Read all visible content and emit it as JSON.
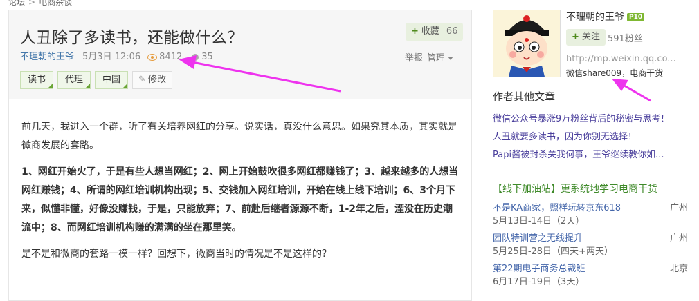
{
  "breadcrumb": {
    "items": [
      "论坛",
      "电商杂谈"
    ]
  },
  "article": {
    "title": "人丑除了多读书，还能做什么？",
    "favorite": {
      "label": "收藏",
      "count": "66"
    },
    "meta": {
      "author": "不理朝的王爷",
      "date": "5月3日 12:06",
      "views": "8412",
      "comments": "35"
    },
    "ops": {
      "report": "举报",
      "manage": "管理"
    },
    "tags": [
      "读书",
      "代理",
      "中国"
    ],
    "edit_label": "修改",
    "paragraphs": [
      {
        "text": "前几天，我进入一个群，听了有关培养网红的分享。说实话，真没什么意思。如果究其本质，其实就是微商发展的套路。",
        "bold": false
      },
      {
        "text": "1、网红开始火了，于是有些人想当网红；2、网上开始鼓吹很多网红都赚钱了；3、越来越多的人想当网红赚钱；4、所谓的网红培训机构出现；5、交钱加入网红培训，开始在线上线下培训；6、3个月下来，似懂非懂，好像没赚钱，于是，只能放弃；7、前赴后继者源源不断，1-2年之后，湮没在历史潮流中；8、而网红培训机构赚的满满的坐在那里笑。",
        "bold": true
      },
      {
        "text": "是不是和微商的套路一模一样？回想下，微商当时的情况是不是这样的？",
        "bold": false
      }
    ]
  },
  "sidebar": {
    "user": {
      "name": "不理朝的王爷",
      "level": "P10",
      "follow_label": "关注",
      "fans": "591粉丝",
      "url": "http://mp.weixin.qq.co...",
      "wechat": "微信share009，电商干货"
    },
    "other_title": "作者其他文章",
    "other_articles": [
      "微信公众号暴涨9万粉丝背后的秘密与思考！",
      "人丑就要多读书，因为你别无选择！",
      "Papi酱被封杀关我何事，王爷继续教你如..."
    ],
    "events_title": "【线下加油站】更系统地学习电商干货",
    "events": [
      {
        "title": "不是KA商家，照样玩转京东618",
        "city": "广州",
        "date": "5月13日-14日（2天）"
      },
      {
        "title": "团队特训营之无线提升",
        "city": "广州",
        "date": "5月25日-28日（四天+两天）"
      },
      {
        "title": "第22期电子商务总裁班",
        "city": "北京",
        "date": "6月17日-19日（3天）"
      }
    ]
  },
  "colors": {
    "accent_green": "#6aa536",
    "link_blue": "#4477aa",
    "annotation_arrow": "#ee33ee"
  }
}
